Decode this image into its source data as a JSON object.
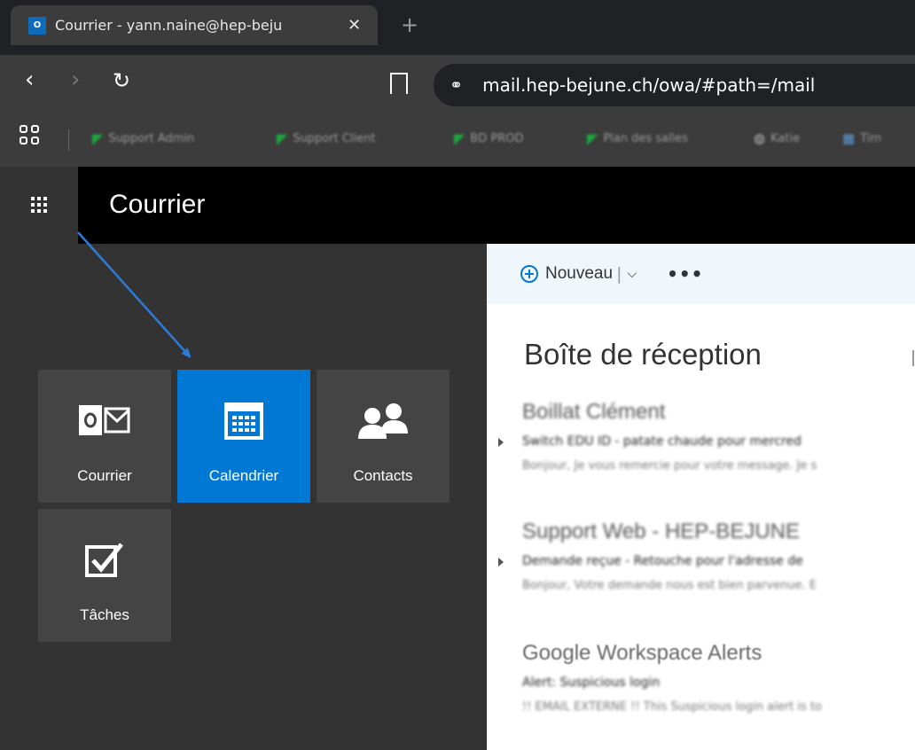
{
  "browser": {
    "tab": {
      "favicon_text": "O",
      "title": "Courrier - yann.naine@hep-beju",
      "close": "✕"
    },
    "new_tab": "+",
    "nav": {
      "back": "‹",
      "forward": "›",
      "reload": "↻"
    },
    "url": "mail.hep-bejune.ch/owa/#path=/mail",
    "tune_icon": "⚭",
    "bookmarks": [
      {
        "label": "Support Admin",
        "icon": "leaf-icon"
      },
      {
        "label": "Support Client",
        "icon": "leaf-icon"
      },
      {
        "label": "BD PROD",
        "icon": "leaf-icon"
      },
      {
        "label": "Plan des salles",
        "icon": "leaf-icon"
      },
      {
        "label": "Katie",
        "icon": "globe-icon"
      },
      {
        "label": "Tim",
        "icon": "app-icon"
      }
    ]
  },
  "owa": {
    "header_title": "Courrier",
    "tiles": [
      {
        "label": "Courrier",
        "icon": "outlook-mail-icon"
      },
      {
        "label": "Calendrier",
        "icon": "calendar-icon"
      },
      {
        "label": "Contacts",
        "icon": "people-icon"
      },
      {
        "label": "Tâches",
        "icon": "checkbox-icon"
      }
    ],
    "active_tile": "Calendrier",
    "cmdbar": {
      "new_label": "Nouveau",
      "separator": "|",
      "chevron": "⌵",
      "more": "•••"
    },
    "inbox_title": "Boîte de réception",
    "messages": [
      {
        "sender": "Boillat Clément",
        "subject": "Switch EDU ID - patate chaude pour mercred",
        "preview": "Bonjour, Je vous remercie pour votre message. Je s"
      },
      {
        "sender": "Support Web - HEP-BEJUNE",
        "subject": "Demande reçue - Retouche pour l'adresse de",
        "preview": "Bonjour, Votre demande nous est bien parvenue. E"
      },
      {
        "sender": "Google Workspace Alerts",
        "subject": "Alert: Suspicious login",
        "preview": "!! EMAIL EXTERNE !! This Suspicious login alert is to"
      }
    ]
  },
  "colors": {
    "accent": "#0078d4",
    "tile_bg": "#444444",
    "panel_bg": "#333333",
    "cmdbar_bg": "#eff6fc",
    "annotation_arrow": "#2e7bd6"
  }
}
